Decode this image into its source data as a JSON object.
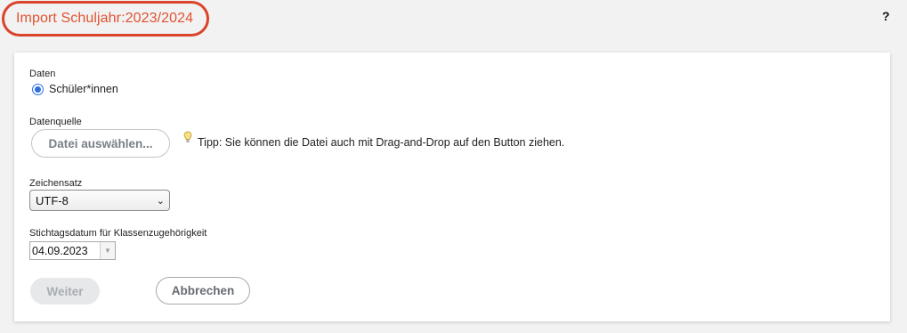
{
  "header": {
    "title": "Import Schuljahr:2023/2024",
    "help_label": "?"
  },
  "form": {
    "data_section": {
      "label": "Daten",
      "option_label": "Schüler*innen",
      "selected": true
    },
    "source_section": {
      "label": "Datenquelle",
      "file_button_label": "Datei auswählen...",
      "tip_icon": "lightbulb-icon",
      "tip_text": "Tipp: Sie können die Datei auch mit Drag-and-Drop auf den Button ziehen."
    },
    "charset_section": {
      "label": "Zeichensatz",
      "selected_value": "UTF-8"
    },
    "date_section": {
      "label": "Stichtagsdatum für Klassenzugehörigkeit",
      "value": "04.09.2023"
    },
    "buttons": {
      "next_label": "Weiter",
      "cancel_label": "Abbrechen"
    }
  },
  "colors": {
    "title_accent": "#e0522f",
    "title_border": "#d9442b",
    "radio_accent": "#2d6fe0"
  }
}
